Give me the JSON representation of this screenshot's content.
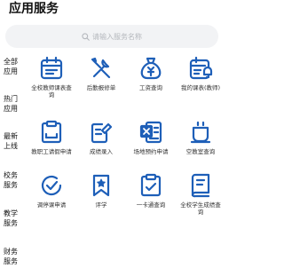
{
  "header": {
    "title": "应用服务"
  },
  "search": {
    "placeholder": "请输入服务名称"
  },
  "sidebar": {
    "items": [
      {
        "label": "全部应用"
      },
      {
        "label": "热门应用"
      },
      {
        "label": "最新上线"
      },
      {
        "label": "校务服务"
      },
      {
        "label": "教学服务"
      },
      {
        "label": "财务服务"
      }
    ]
  },
  "services": [
    {
      "label": "全校教师课表查询",
      "icon": "calendar-icon"
    },
    {
      "label": "后勤报修单",
      "icon": "wrench-icon"
    },
    {
      "label": "工资查询",
      "icon": "money-bag-icon"
    },
    {
      "label": "我的课表(教师)",
      "icon": "calendar-bell-icon"
    },
    {
      "label": "教职工请假申请",
      "icon": "clipboard-icon"
    },
    {
      "label": "成绩录入",
      "icon": "edit-icon"
    },
    {
      "label": "场地预约申请",
      "icon": "excel-icon"
    },
    {
      "label": "空教室查询",
      "icon": "cup-icon"
    },
    {
      "label": "调停课申请",
      "icon": "check-circle-icon"
    },
    {
      "label": "评学",
      "icon": "bookmark-star-icon"
    },
    {
      "label": "一卡通查询",
      "icon": "clipboard-check-icon"
    },
    {
      "label": "全校学生成绩查询",
      "icon": "book-icon"
    }
  ],
  "colors": {
    "accent": "#1e5fb8",
    "search_bg": "#f2f3f5",
    "placeholder": "#b5b8bd"
  }
}
